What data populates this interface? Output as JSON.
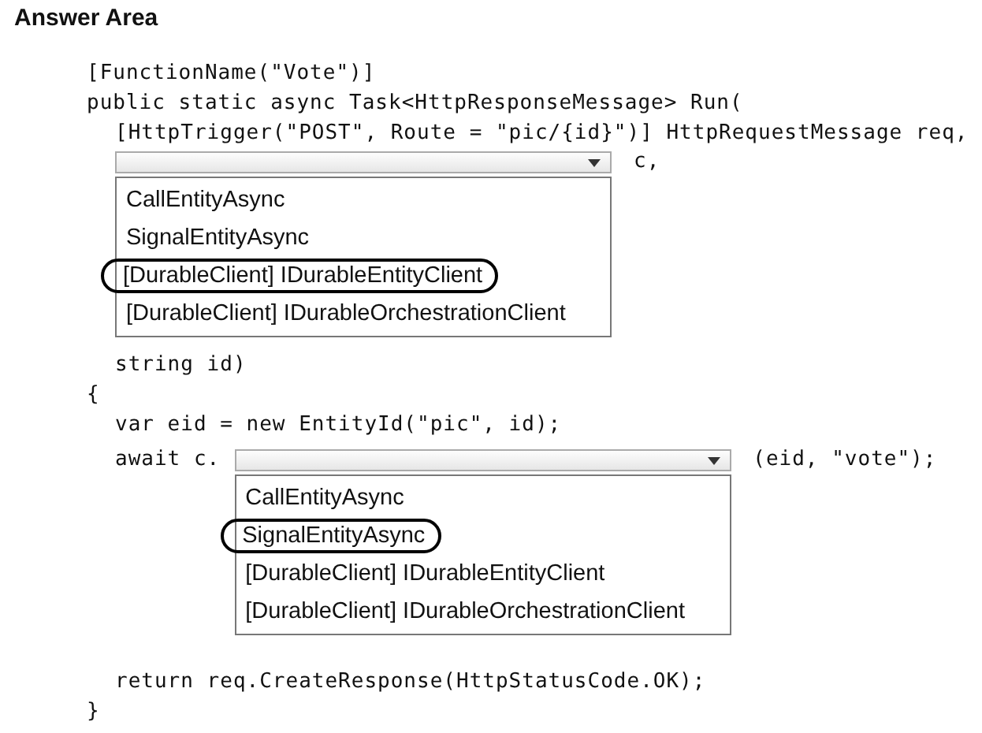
{
  "title": "Answer Area",
  "code": [
    {
      "kind": "code",
      "text": "[FunctionName(\"Vote\")]"
    },
    {
      "kind": "code",
      "text": "public static async Task<HttpResponseMessage> Run(",
      "children": [
        {
          "kind": "code",
          "text": "[HttpTrigger(\"POST\", Route = \"pic/{id}\")] HttpRequestMessage req,"
        },
        {
          "kind": "dropdown",
          "suffix": "c,",
          "options": [
            {
              "label": "CallEntityAsync",
              "selected": false
            },
            {
              "label": "SignalEntityAsync",
              "selected": false
            },
            {
              "label": "[DurableClient] IDurableEntityClient",
              "selected": true
            },
            {
              "label": "[DurableClient] IDurableOrchestrationClient",
              "selected": false
            }
          ]
        },
        {
          "kind": "code",
          "text": "string id)"
        }
      ]
    },
    {
      "kind": "code",
      "text": "{",
      "children": [
        {
          "kind": "code",
          "text": "var eid = new EntityId(\"pic\", id);"
        },
        {
          "kind": "dropdown",
          "prefix": "await c.",
          "suffix": "(eid, \"vote\");",
          "options": [
            {
              "label": "CallEntityAsync",
              "selected": false
            },
            {
              "label": "SignalEntityAsync",
              "selected": true
            },
            {
              "label": "[DurableClient] IDurableEntityClient",
              "selected": false
            },
            {
              "label": "[DurableClient] IDurableOrchestrationClient",
              "selected": false
            }
          ]
        },
        {
          "kind": "code",
          "text": "return req.CreateResponse(HttpStatusCode.OK);"
        }
      ]
    },
    {
      "kind": "code",
      "text": "}"
    }
  ]
}
